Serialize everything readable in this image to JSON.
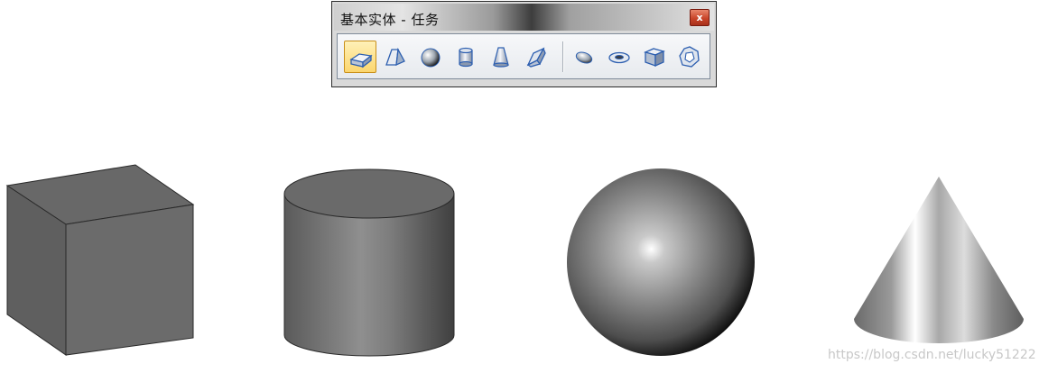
{
  "toolbar_window": {
    "title": "基本实体 - 任务",
    "close_label": "x",
    "buttons": [
      {
        "icon": "box-icon",
        "active": true
      },
      {
        "icon": "wedge-icon",
        "active": false
      },
      {
        "icon": "sphere-icon",
        "active": false
      },
      {
        "icon": "cylinder-icon",
        "active": false
      },
      {
        "icon": "cone-icon",
        "active": false
      },
      {
        "icon": "pyramid-icon",
        "active": false
      },
      {
        "icon": "ellipsoid-icon",
        "active": false
      },
      {
        "icon": "torus-icon",
        "active": false
      },
      {
        "icon": "cube-icon",
        "active": false
      },
      {
        "icon": "polyhedron-icon",
        "active": false
      }
    ]
  },
  "canvas": {
    "solids": [
      "cube",
      "cylinder",
      "sphere",
      "cone"
    ],
    "shape_color": "#6b6b6b"
  },
  "watermark": "https://blog.csdn.net/lucky51222"
}
